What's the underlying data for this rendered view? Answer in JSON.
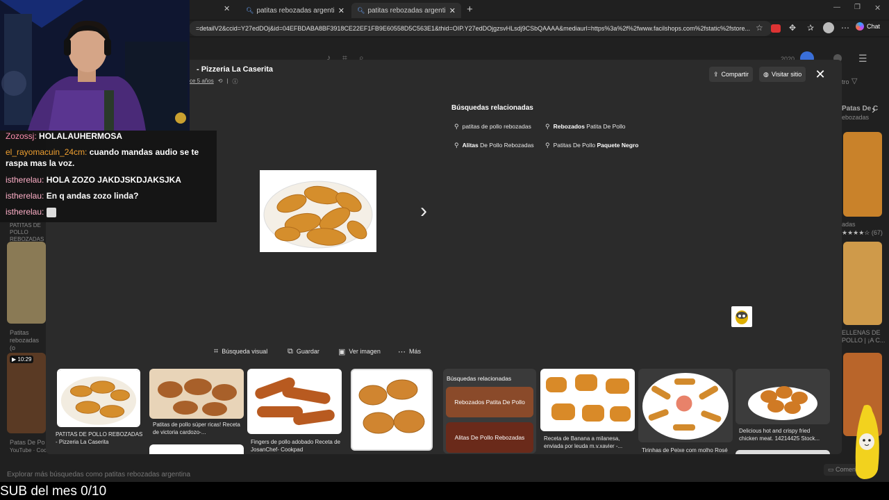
{
  "browser": {
    "tabs": [
      {
        "title": "patitas rebozadas argentina - Búsq",
        "close": "✕"
      },
      {
        "title": "patitas rebozadas argentina - Búsq",
        "close": "✕"
      }
    ],
    "url": "=detailV2&ccid=Y27edDOj&id=04EFBDABA8BF3918CE22EF1FB9E60558D5C563E1&thid=OIP.Y27edDOjgzsvHLsdj9CSbQAAAA&mediaurl=https%3a%2f%2fwww.facilshops.com%2fstatic%2fstore...",
    "chat_label": "Chat"
  },
  "modal": {
    "title": "- Pizzeria La Caserita",
    "subtitle": "ce 5 años",
    "share_label": "Compartir",
    "visit_label": "Visitar sitio",
    "related_title": "Búsquedas relacionadas",
    "chips": [
      {
        "pre": "",
        "bold": "",
        "post": "patitas de pollo rebozadas"
      },
      {
        "pre": "",
        "bold": "Rebozados",
        "post": " Patita De Pollo"
      },
      {
        "pre": "",
        "bold": "Alitas",
        "post": " De Pollo Rebozadas"
      },
      {
        "pre": "Patitas De Pollo ",
        "bold": "Paquete Negro",
        "post": ""
      }
    ],
    "actions": {
      "visual": "Búsqueda visual",
      "save": "Guardar",
      "view": "Ver imagen",
      "more": "Más"
    }
  },
  "strip": {
    "cards": [
      {
        "caption": "PATITAS DE POLLO REBOZADAS - Pizzeria La Caserita"
      },
      {
        "caption": "Patitas de pollo súper ricas! Receta de victoria cardozo-..."
      },
      {
        "caption": "Fingers de pollo adobado Receta de JosanChef- Cookpad"
      },
      {
        "caption": ""
      },
      {
        "caption": "Receta de Banana a milanesa, enviada por leuda m.v.xavier -..."
      },
      {
        "caption": "Tirinhas de Peixe com molho Rosé"
      },
      {
        "caption": "Delicious hot and crispy fried chicken meat. 14214425 Stock..."
      }
    ],
    "related": {
      "title": "Búsquedas relacionadas",
      "items": [
        "Rebozados Patita De Pollo",
        "Alitas De Pollo Rebozadas"
      ]
    }
  },
  "background": {
    "right_title": "Patas De C",
    "right_sub": "ebozadas",
    "right_rating": "(67)",
    "right_bottom": "ELLENAS DE POLLO | ¡A C...",
    "left_title": "PATITAS DE POLLO REBOZADAS",
    "left_caption": "Patitas rebozadas (o",
    "left_caption2": "Patas De Po",
    "left_source": "YouTube · Cocin",
    "video_time": "10:29",
    "year": "2020",
    "filter": "tro",
    "bottom_hint": "Explorar más búsquedas como patitas rebozadas argentina",
    "comment": "Comen"
  },
  "chat": [
    {
      "user": "Zozossj:",
      "user_color": "#ff8fb0",
      "msg": "HOLALAUHERMOSA"
    },
    {
      "user": "el_rayomacuin_24cm:",
      "user_color": "#f0a030",
      "msg": "cuando mandas audio se te raspa mas la voz."
    },
    {
      "user": "istherelau:",
      "user_color": "#ffb0c8",
      "msg": "HOLA ZOZO JAKDJSKDJAKSJKA"
    },
    {
      "user": "istherelau:",
      "user_color": "#ffb0c8",
      "msg": "En q andas zozo linda?"
    },
    {
      "user": "istherelau:",
      "user_color": "#ffb0c8",
      "msg": ""
    }
  ],
  "stream": {
    "sub_goal": "SUB del mes 0/10"
  },
  "colors": {
    "modal_bg": "#2b2b2b",
    "chrome_bg": "#202020",
    "nugget": "#d9922e"
  }
}
